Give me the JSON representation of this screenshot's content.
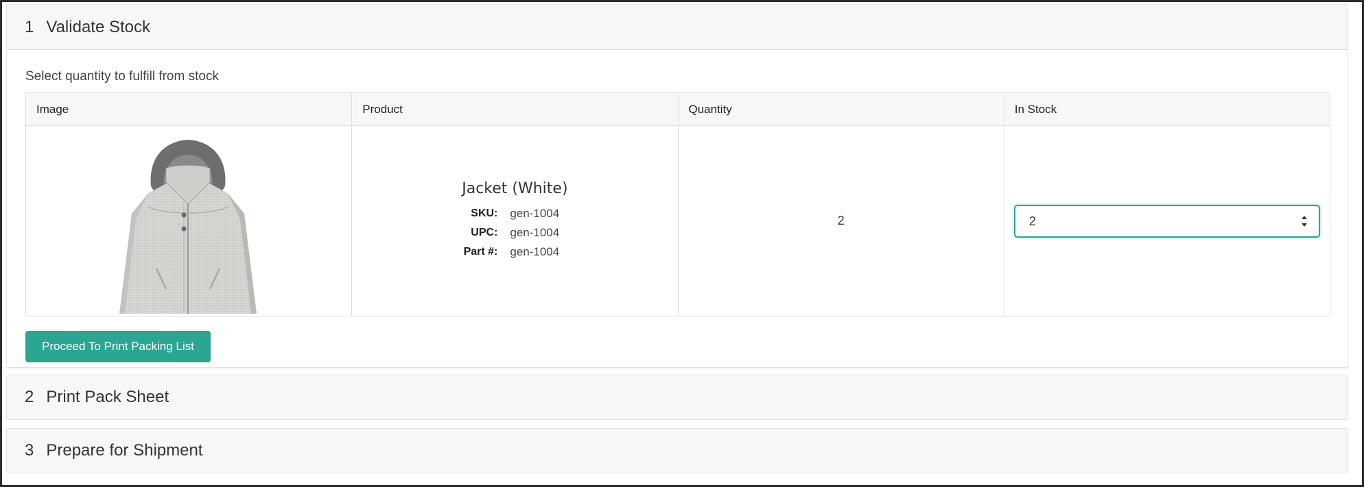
{
  "steps": [
    {
      "number": "1",
      "title": "Validate Stock"
    },
    {
      "number": "2",
      "title": "Print Pack Sheet"
    },
    {
      "number": "3",
      "title": "Prepare for Shipment"
    }
  ],
  "validate": {
    "instruction": "Select quantity to fulfill from stock",
    "table": {
      "headers": [
        "Image",
        "Product",
        "Quantity",
        "In Stock"
      ],
      "rows": [
        {
          "image_icon": "jacket-image",
          "product_name": "Jacket (White)",
          "sku_label": "SKU:",
          "sku_value": "gen-1004",
          "upc_label": "UPC:",
          "upc_value": "gen-1004",
          "part_label": "Part #:",
          "part_value": "gen-1004",
          "quantity": "2",
          "in_stock_value": "2"
        }
      ]
    },
    "proceed_label": "Proceed To Print Packing List"
  },
  "colors": {
    "accent": "#2aa693",
    "header_bg": "#f7f7f7",
    "border": "#dddddd"
  }
}
